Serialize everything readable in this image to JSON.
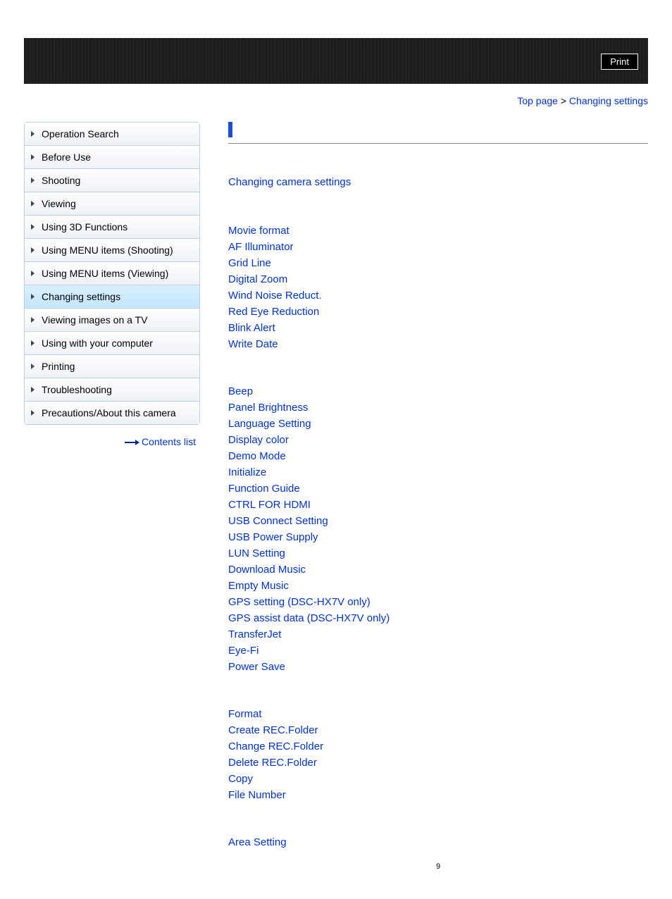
{
  "header": {
    "print_label": "Print"
  },
  "breadcrumb": {
    "top_page": "Top page",
    "sep": ">",
    "current": "Changing settings"
  },
  "sidebar": {
    "items": [
      {
        "label": "Operation Search",
        "active": false
      },
      {
        "label": "Before Use",
        "active": false
      },
      {
        "label": "Shooting",
        "active": false
      },
      {
        "label": "Viewing",
        "active": false
      },
      {
        "label": "Using 3D Functions",
        "active": false
      },
      {
        "label": "Using MENU items (Shooting)",
        "active": false
      },
      {
        "label": "Using MENU items (Viewing)",
        "active": false
      },
      {
        "label": "Changing settings",
        "active": true
      },
      {
        "label": "Viewing images on a TV",
        "active": false
      },
      {
        "label": "Using with your computer",
        "active": false
      },
      {
        "label": "Printing",
        "active": false
      },
      {
        "label": "Troubleshooting",
        "active": false
      },
      {
        "label": "Precautions/About this camera",
        "active": false
      }
    ],
    "contents_list": "Contents list"
  },
  "main": {
    "page_title": "",
    "section_heading": "Changing camera settings",
    "groups": [
      {
        "heading": "",
        "items": [
          "Movie format",
          "AF Illuminator",
          "Grid Line",
          "Digital Zoom",
          "Wind Noise Reduct.",
          "Red Eye Reduction",
          "Blink Alert",
          "Write Date"
        ]
      },
      {
        "heading": "",
        "items": [
          "Beep",
          "Panel Brightness",
          "Language Setting",
          "Display color",
          "Demo Mode",
          "Initialize",
          "Function Guide",
          "CTRL FOR HDMI",
          "USB Connect Setting",
          "USB Power Supply",
          "LUN Setting",
          "Download Music",
          "Empty Music",
          "GPS setting (DSC-HX7V only)",
          "GPS assist data (DSC-HX7V only)",
          "TransferJet",
          "Eye-Fi",
          "Power Save"
        ]
      },
      {
        "heading": "",
        "items": [
          "Format",
          "Create REC.Folder",
          "Change REC.Folder",
          "Delete REC.Folder",
          "Copy",
          "File Number"
        ]
      },
      {
        "heading": "",
        "items": [
          "Area Setting"
        ]
      }
    ],
    "page_number": "9"
  }
}
